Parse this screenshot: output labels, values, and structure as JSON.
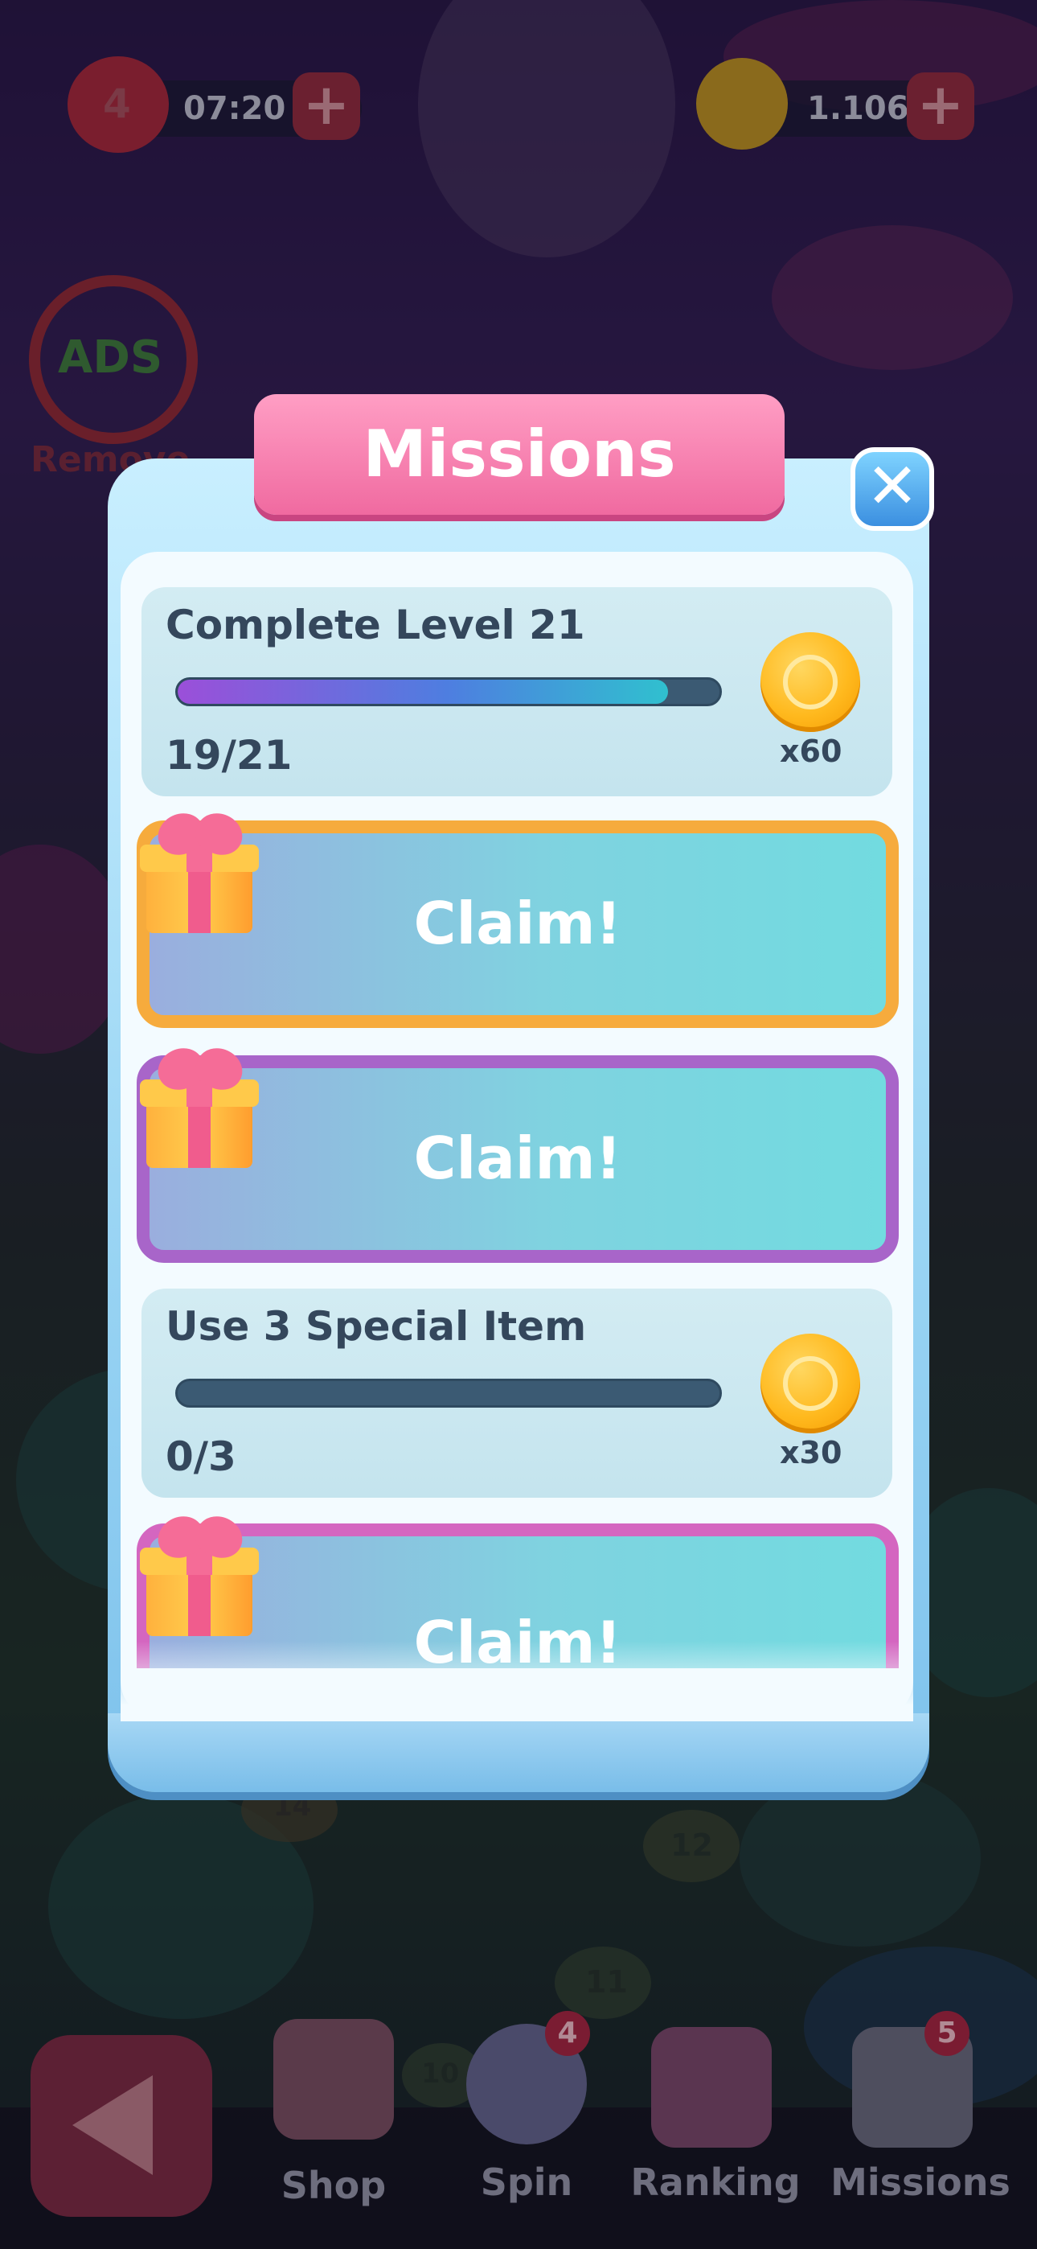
{
  "hud": {
    "lives": "4",
    "timer": "07:20",
    "coins": "1.106",
    "plus_label": "+"
  },
  "ads": {
    "ads_text": "ADS",
    "remove_label": "Remove Ads"
  },
  "dialog": {
    "title": "Missions",
    "close_label": "✕"
  },
  "missions": [
    {
      "title": "Complete Level 21",
      "progress_text": "19/21",
      "progress": 0.905,
      "reward": "x60"
    },
    {
      "title": "Use 3 Special Item",
      "progress_text": "0/3",
      "progress": 0.0,
      "reward": "x30"
    }
  ],
  "claims": [
    {
      "label": "Claim!",
      "border_color": "#f6ab3d"
    },
    {
      "label": "Claim!",
      "border_color": "#a865c9"
    },
    {
      "label": "Claim!",
      "border_color": "#d466c0"
    }
  ],
  "bottom_nav": {
    "items": [
      {
        "label": "Shop",
        "icon": "shop-icon"
      },
      {
        "label": "Spin",
        "icon": "spin-wheel-icon",
        "badge": "4"
      },
      {
        "label": "Ranking",
        "icon": "ranking-icon"
      },
      {
        "label": "Missions",
        "icon": "missions-icon",
        "badge": "5"
      }
    ],
    "back_icon": "back-arrow-icon"
  },
  "map": {
    "level_nodes": [
      "14",
      "12",
      "11",
      "10"
    ]
  }
}
